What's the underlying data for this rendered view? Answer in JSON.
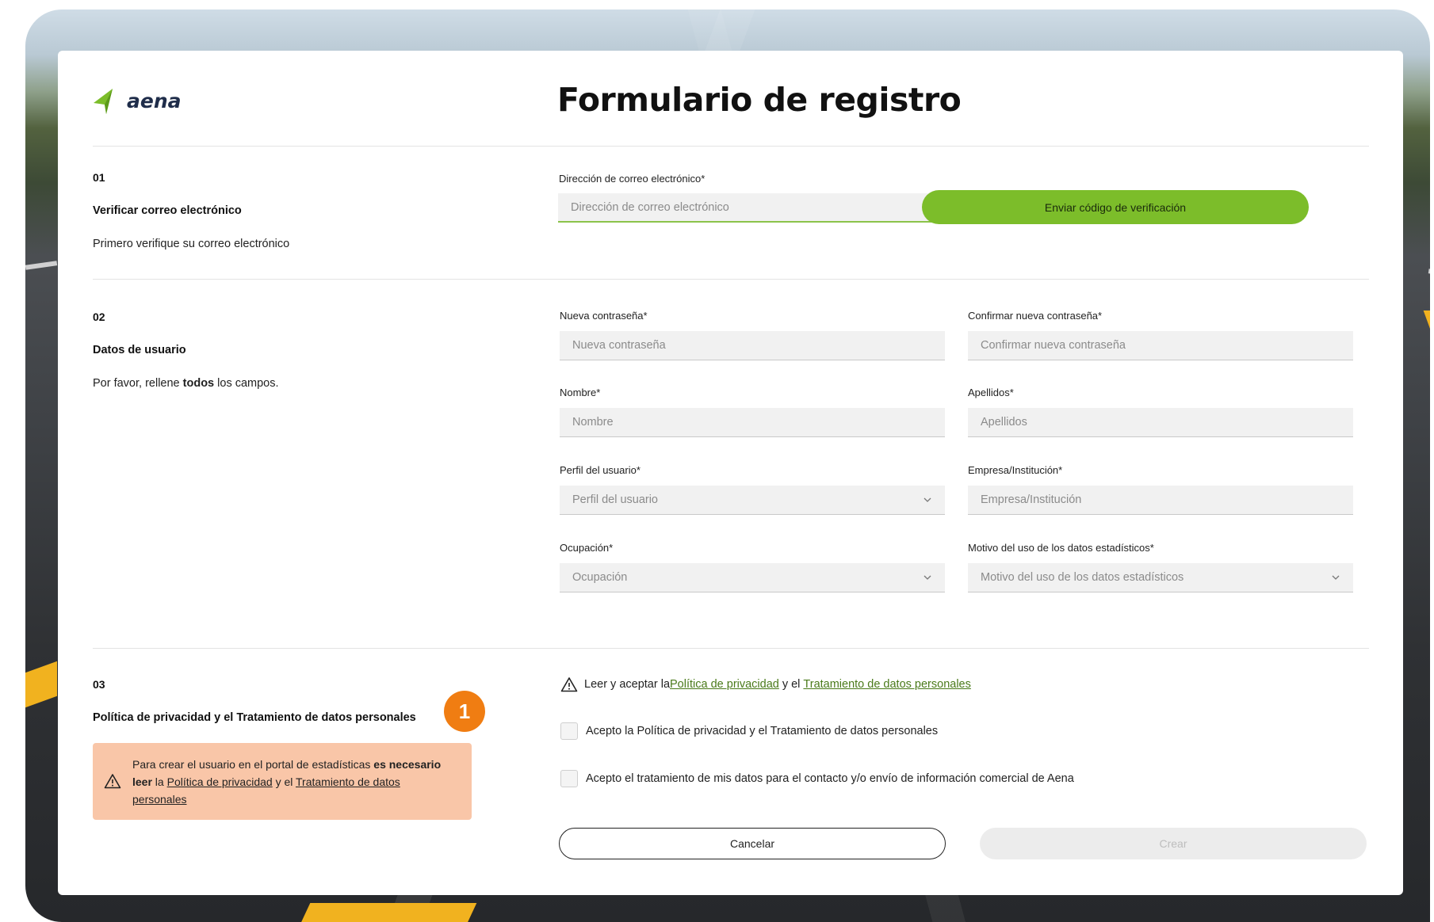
{
  "brand": {
    "name": "aena",
    "accent": "#7cbd2a",
    "badge_color": "#f07d12",
    "warning_bg": "#f9c6a8"
  },
  "page_title": "Formulario de registro",
  "section1": {
    "num": "01",
    "title": "Verificar correo electrónico",
    "desc": "Primero verifique su correo electrónico",
    "email_label": "Dirección de correo electrónico*",
    "email_placeholder": "Dirección de correo electrónico",
    "send_button": "Enviar código de verificación"
  },
  "section2": {
    "num": "02",
    "title": "Datos de usuario",
    "desc_pre": "Por favor, rellene ",
    "desc_bold": "todos",
    "desc_post": " los campos.",
    "password_label": "Nueva contraseña*",
    "password_placeholder": "Nueva contraseña",
    "confirm_label": "Confirmar nueva contraseña*",
    "confirm_placeholder": "Confirmar nueva contraseña",
    "name_label": "Nombre*",
    "name_placeholder": "Nombre",
    "surname_label": "Apellidos*",
    "surname_placeholder": "Apellidos",
    "profile_label": "Perfil del usuario*",
    "profile_placeholder": "Perfil del usuario",
    "company_label": "Empresa/Institución*",
    "company_placeholder": "Empresa/Institución",
    "occupation_label": "Ocupación*",
    "occupation_placeholder": "Ocupación",
    "reason_label": "Motivo del uso de los datos estadísticos*",
    "reason_placeholder": "Motivo del uso de los datos estadísticos"
  },
  "section3": {
    "num": "03",
    "title": "Política de privacidad y el Tratamiento de datos personales",
    "badge": "1",
    "warning_pre": "Para crear el usuario en el portal de estadísticas ",
    "warning_bold": "es necesario leer",
    "warning_mid": " la ",
    "warning_link1": "Política de privacidad",
    "warning_and": " y el ",
    "warning_link2": "Tratamiento de datos personales",
    "read_pre": "Leer y aceptar la ",
    "read_link1": "Política de privacidad",
    "read_and": " y el ",
    "read_link2": "Tratamiento de datos personales",
    "check1": "Acepto la Política de privacidad y el Tratamiento de datos personales",
    "check2": "Acepto el tratamiento de mis datos para el contacto y/o envío de información comercial de Aena",
    "cancel_button": "Cancelar",
    "create_button": "Crear"
  }
}
